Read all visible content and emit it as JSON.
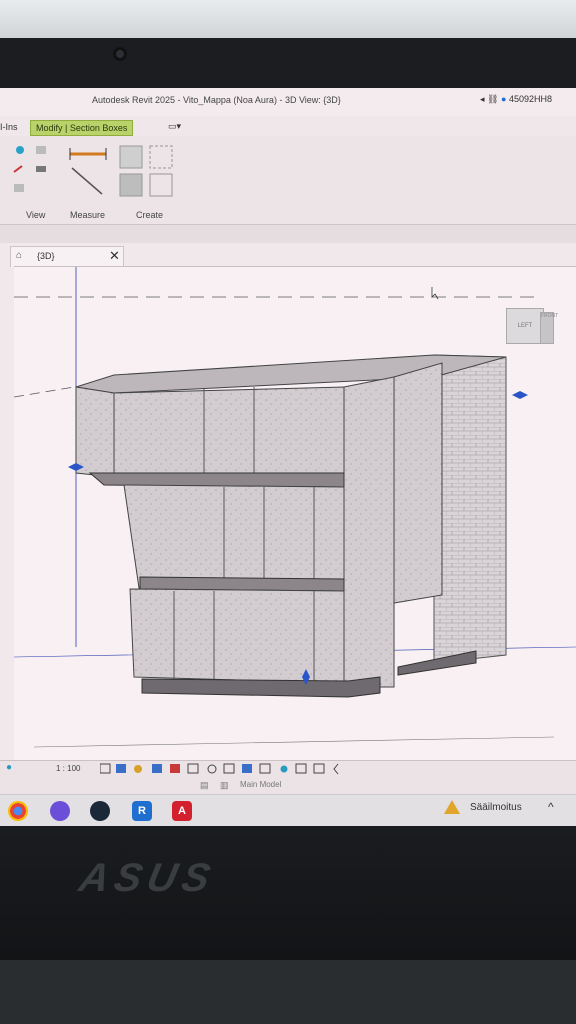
{
  "window": {
    "title": "Autodesk Revit 2025 - Vito_Mappa (Noa Aura) - 3D View: {3D}",
    "user": "45092HH8"
  },
  "ribbon": {
    "tab_addins": "I-Ins",
    "tab_modify": "Modify | Section Boxes",
    "panels": [
      "View",
      "Measure",
      "Create"
    ]
  },
  "view": {
    "tab_label": "{3D}",
    "close_symbol": "✕",
    "viewcube_left": "LEFT",
    "viewcube_front": "FRONT",
    "scale": "1 : 100",
    "model": "Main Model"
  },
  "taskbar": {
    "notification": "Sääilmoitus"
  },
  "brand": {
    "logo_text": "ASUS"
  },
  "colors": {
    "modify_tab": "#b9d36a",
    "revit_blue": "#1f6fd1",
    "acrobat_red": "#d3202f"
  }
}
